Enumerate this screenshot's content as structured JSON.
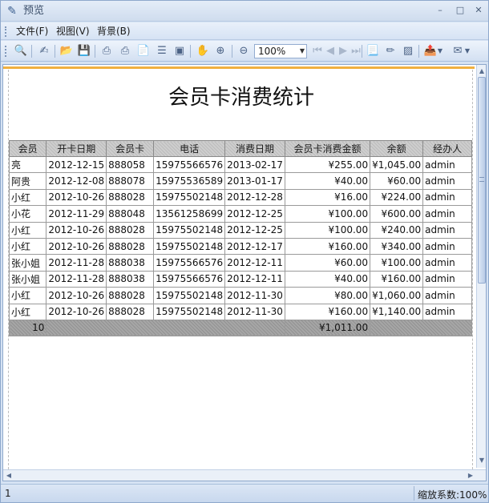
{
  "window": {
    "title": "预览"
  },
  "menu": {
    "file": "文件(F)",
    "view": "视图(V)",
    "background": "背景(B)"
  },
  "toolbar": {
    "zoom_value": "100%"
  },
  "report": {
    "title": "会员卡消费统计",
    "columns": [
      "会员",
      "开卡日期",
      "会员卡",
      "电话",
      "消费日期",
      "会员卡消费金额",
      "余额",
      "经办人"
    ],
    "rows": [
      [
        "亮",
        "2012-12-15",
        "888058",
        "15975566576",
        "2013-02-17",
        "¥255.00",
        "¥1,045.00",
        "admin"
      ],
      [
        "阿贵",
        "2012-12-08",
        "888078",
        "15975536589",
        "2013-01-17",
        "¥40.00",
        "¥60.00",
        "admin"
      ],
      [
        "小红",
        "2012-10-26",
        "888028",
        "15975502148",
        "2012-12-28",
        "¥16.00",
        "¥224.00",
        "admin"
      ],
      [
        "小花",
        "2012-11-29",
        "888048",
        "13561258699",
        "2012-12-25",
        "¥100.00",
        "¥600.00",
        "admin"
      ],
      [
        "小红",
        "2012-10-26",
        "888028",
        "15975502148",
        "2012-12-25",
        "¥100.00",
        "¥240.00",
        "admin"
      ],
      [
        "小红",
        "2012-10-26",
        "888028",
        "15975502148",
        "2012-12-17",
        "¥160.00",
        "¥340.00",
        "admin"
      ],
      [
        "张小姐",
        "2012-11-28",
        "888038",
        "15975566576",
        "2012-12-11",
        "¥60.00",
        "¥100.00",
        "admin"
      ],
      [
        "张小姐",
        "2012-11-28",
        "888038",
        "15975566576",
        "2012-12-11",
        "¥40.00",
        "¥160.00",
        "admin"
      ],
      [
        "小红",
        "2012-10-26",
        "888028",
        "15975502148",
        "2012-11-30",
        "¥80.00",
        "¥1,060.00",
        "admin"
      ],
      [
        "小红",
        "2012-10-26",
        "888028",
        "15975502148",
        "2012-11-30",
        "¥160.00",
        "¥1,140.00",
        "admin"
      ]
    ],
    "total_count": "10",
    "total_amount": "¥1,011.00"
  },
  "status": {
    "page": "1",
    "zoom_factor": "缩放系数:100%"
  }
}
